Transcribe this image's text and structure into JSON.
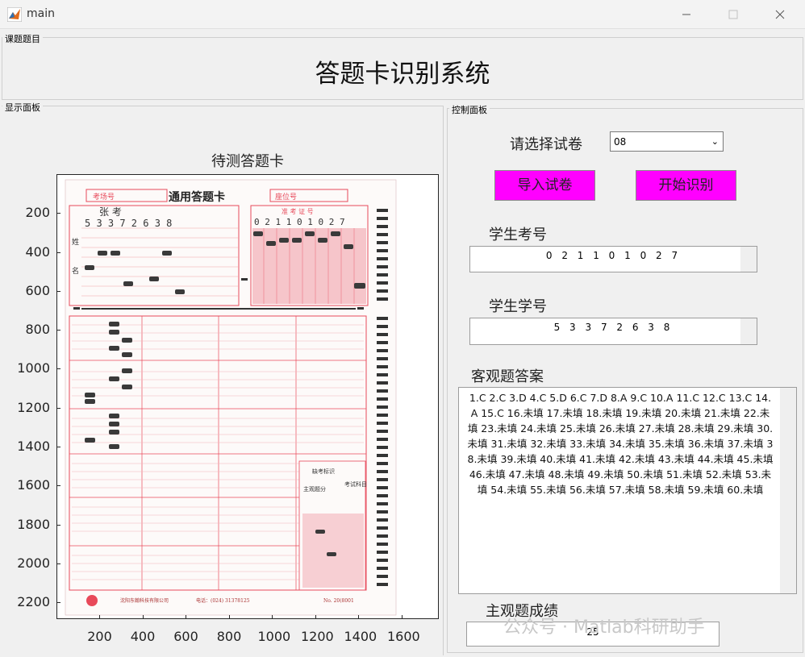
{
  "window": {
    "title": "main"
  },
  "panels": {
    "topic": "课题题目",
    "display": "显示面板",
    "control": "控制面板"
  },
  "app_title": "答题卡识别系统",
  "axes": {
    "title": "待测答题卡",
    "x_ticks": [
      "200",
      "400",
      "600",
      "800",
      "1000",
      "1200",
      "1400",
      "1600"
    ],
    "y_ticks": [
      "200",
      "400",
      "600",
      "800",
      "1000",
      "1200",
      "1400",
      "1600",
      "1800",
      "2000",
      "2200"
    ]
  },
  "card": {
    "exam_room_label": "考场号",
    "heading": "通用答题卡",
    "seat_label": "座位号",
    "name_label": "姓",
    "name_label2": "名",
    "handwritten_name": "张 考",
    "student_digits": "5 3 3 7 2 6 3 8",
    "exam_no_label": "准 考 证 号",
    "exam_digits": "0 2 1 1 0 1 0 2 7",
    "mark_label": "缺考标识",
    "subjective_label": "主观题分",
    "subject_label": "考试科目",
    "footer_company": "沈阳东翰科技有限公司",
    "footer_phone": "电话：(024) 31378125",
    "footer_no": "No. 20(8001"
  },
  "controls": {
    "select_label": "请选择试卷",
    "select_value": "08",
    "import_button": "导入试卷",
    "start_button": "开始识别",
    "exam_no_label": "学生考号",
    "exam_no_value": "0 2 1 1 0 1 0 2 7",
    "student_id_label": "学生学号",
    "student_id_value": "5 3 3 7 2 6 3 8",
    "objective_label": "客观题答案",
    "objective_answers": "1.C  2.C  3.D  4.C  5.D  6.C  7.D  8.A  9.C  10.A  11.C  12.C  13.C  14.A  15.C  16.未填  17.未填  18.未填  19.未填  20.未填  21.未填  22.未填  23.未填  24.未填  25.未填  26.未填  27.未填  28.未填  29.未填  30.未填  31.未填  32.未填  33.未填  34.未填  35.未填  36.未填  37.未填  38.未填  39.未填  40.未填  41.未填  42.未填  43.未填  44.未填  45.未填  46.未填  47.未填  48.未填  49.未填  50.未填  51.未填  52.未填  53.未填  54.未填  55.未填  56.未填  57.未填  58.未填  59.未填  60.未填",
    "subjective_label": "主观题成绩",
    "subjective_value": "25"
  },
  "watermark": "公众号 · Matlab科研助手",
  "colors": {
    "button": "#ff00ff",
    "card_red": "#e8495a"
  }
}
